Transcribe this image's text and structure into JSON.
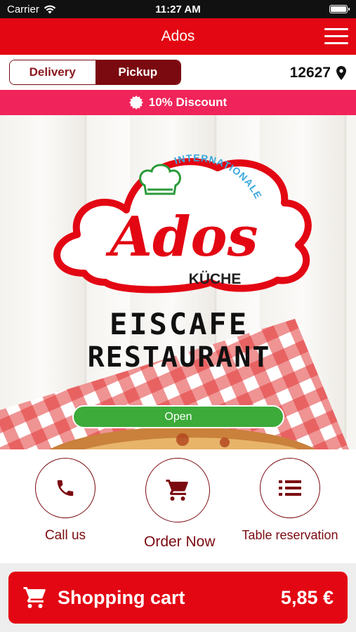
{
  "status_bar": {
    "carrier": "Carrier",
    "time": "11:27 AM"
  },
  "nav": {
    "title": "Ados"
  },
  "order_mode": {
    "delivery_label": "Delivery",
    "pickup_label": "Pickup",
    "selected": "Pickup"
  },
  "postcode": "12627",
  "promo": {
    "text": "10% Discount"
  },
  "hero": {
    "logo_word": "Ados",
    "logo_arc": "INTERNATIONALE",
    "logo_sub": "KÜCHE",
    "line1": "EISCAFE",
    "line2": "RESTAURANT",
    "status": "Open"
  },
  "actions": {
    "call_label": "Call us",
    "order_label": "Order Now",
    "table_label": "Table reservation"
  },
  "cart": {
    "label": "Shopping cart",
    "total": "5,85 €"
  },
  "colors": {
    "brand_red": "#e30613",
    "dark_red": "#7b0a10",
    "discount_pink": "#f0245a",
    "open_green": "#3cab3a"
  },
  "icons": [
    "wifi-icon",
    "battery-icon",
    "hamburger-menu-icon",
    "location-pin-icon",
    "badge-icon",
    "phone-icon",
    "cart-icon",
    "list-icon"
  ]
}
